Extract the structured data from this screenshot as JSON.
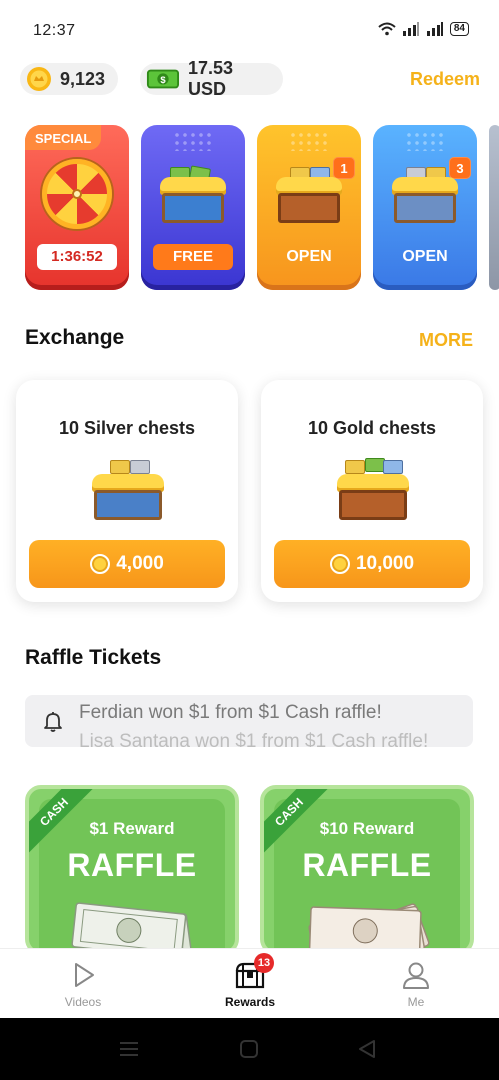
{
  "status_bar": {
    "time": "12:37",
    "battery": "84",
    "icons": [
      "wifi-icon",
      "signal-icon",
      "signal-icon",
      "battery-icon"
    ]
  },
  "balance": {
    "coins": "9,123",
    "cash": "17.53 USD",
    "redeem_label": "Redeem"
  },
  "chests": [
    {
      "tag": "SPECIAL",
      "timer": "1:36:52",
      "color": "#e6332c"
    },
    {
      "button": "FREE",
      "color": "#3a35d1"
    },
    {
      "button": "OPEN",
      "badge": "1",
      "color": "#f7941d"
    },
    {
      "button": "OPEN",
      "badge": "3",
      "color": "#3a78e6"
    }
  ],
  "exchange": {
    "title": "Exchange",
    "more_label": "MORE",
    "items": [
      {
        "title": "10 Silver chests",
        "price": "4,000"
      },
      {
        "title": "10 Gold chests",
        "price": "10,000"
      }
    ]
  },
  "raffle": {
    "title": "Raffle Tickets",
    "ticker": "Ferdian won $1 from $1 Cash raffle!",
    "ticker_next": "Lisa Santana won $1 from $1 Cash raffle!",
    "cards": [
      {
        "ribbon": "CASH",
        "reward": "$1 Reward",
        "label": "RAFFLE"
      },
      {
        "ribbon": "CASH",
        "reward": "$10 Reward",
        "label": "RAFFLE"
      }
    ]
  },
  "bottom_nav": {
    "items": [
      {
        "label": "Videos"
      },
      {
        "label": "Rewards",
        "badge": "13"
      },
      {
        "label": "Me"
      }
    ],
    "active": "Rewards"
  },
  "colors": {
    "accent": "#f5b21a",
    "button_orange": "#f7961a",
    "raffle_green": "#86d16b"
  }
}
